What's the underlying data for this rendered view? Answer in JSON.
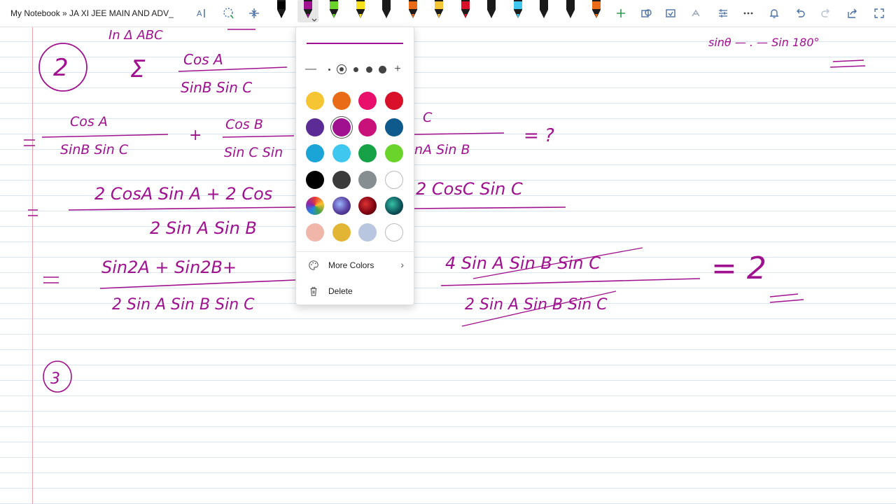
{
  "breadcrumb": "My Notebook » JA XI JEE MAIN AND ADV_",
  "panel": {
    "more_colors_label": "More Colors",
    "delete_label": "Delete",
    "selected_color": "#a0118f"
  },
  "swatches": [
    [
      "#f6c533",
      "#ea6b17",
      "#e8106a",
      "#d8102a"
    ],
    [
      "#5b2c96",
      "#a0118f",
      "#c9117a",
      "#0e5a8c"
    ],
    [
      "#1aa5d6",
      "#40c7f0",
      "#17a248",
      "#6bd42b"
    ],
    [
      "#000000",
      "#3a3a3a",
      "#868e91",
      "#ffffff"
    ],
    [
      "rainbow",
      "galaxy",
      "ruby",
      "ocean"
    ],
    [
      "#f0b6aa",
      "#e3b535",
      "#b9c6e0",
      "#ffffff"
    ]
  ],
  "pen_colors": [
    "#000000",
    "#a0118f",
    "#6bd42b",
    "#f6e01b",
    "#1a1a1a",
    "#ea6b17",
    "#f6c533",
    "#d8102a",
    "#1a1a1a",
    "#40c7f0",
    "#1a1a1a",
    "#1a1a1a",
    "#ea6b17"
  ],
  "icons": [
    "text-select-icon",
    "lasso-icon",
    "insert-space-icon",
    "add-pen-icon",
    "shapes-icon",
    "convert-icon",
    "math-icon",
    "ruler-icon",
    "more-icon",
    "bell-icon",
    "undo-icon",
    "redo-icon",
    "share-icon",
    "fullscreen-icon"
  ],
  "ink": {
    "heading": "In Δ ABC",
    "problem_number_2": "2",
    "sigma": "Σ",
    "sum_numerator": "Cos A",
    "sum_denominator": "SinB Sin C",
    "line1_t1_num": "Cos A",
    "line1_t1_den": "SinB Sin C",
    "line1_t2_num": "Cos B",
    "line1_t2_den": "Sin C Sin",
    "line1_t3_num": "C",
    "line1_t3_den": "nA Sin B",
    "question": "= ?",
    "line2_num_left": "2 CosA Sin A + 2 Cos",
    "line2_num_right": "2 CosC Sin C",
    "line2_den": "2 Sin A Sin B",
    "line3_num_left": "Sin2A + Sin2B+",
    "line3_den_left": "2 Sin A Sin B Sin C",
    "line3_num_right": "4 Sin A Sin B Sin C",
    "line3_den_right": "2 Sin A Sin B Sin C",
    "result": "= 2",
    "problem_number_3": "3",
    "top_right": "sinθ — . — Sin 180°"
  }
}
